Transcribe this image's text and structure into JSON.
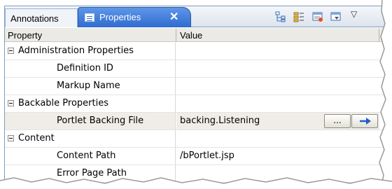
{
  "tabs": {
    "inactive_label": "Annotations",
    "active_label": "Properties",
    "close_glyph": "✕"
  },
  "toolbar": {
    "icons": [
      "show-categories-icon",
      "show-advanced-icon",
      "restore-default-icon",
      "view-menu-icon"
    ],
    "menu_glyph": "▽"
  },
  "table": {
    "headers": [
      "Property",
      "Value"
    ],
    "rows": [
      {
        "kind": "category",
        "label": "Administration Properties",
        "value": ""
      },
      {
        "kind": "property",
        "label": "Definition ID",
        "value": ""
      },
      {
        "kind": "property",
        "label": "Markup Name",
        "value": ""
      },
      {
        "kind": "category",
        "label": "Backable Properties",
        "value": ""
      },
      {
        "kind": "property",
        "label": "Portlet Backing File",
        "value": "backing.Listening",
        "selected": true
      },
      {
        "kind": "category",
        "label": "Content",
        "value": ""
      },
      {
        "kind": "property",
        "label": "Content Path",
        "value": "/bPortlet.jsp"
      },
      {
        "kind": "property",
        "label": "Error Page Path",
        "value": ""
      }
    ],
    "browse_label": "...",
    "go_glyph": "→"
  },
  "colors": {
    "tab_active": "#3a78dc",
    "selection": "#efede6",
    "header_bg": "#ebeae5",
    "border": "#7f9db9"
  }
}
